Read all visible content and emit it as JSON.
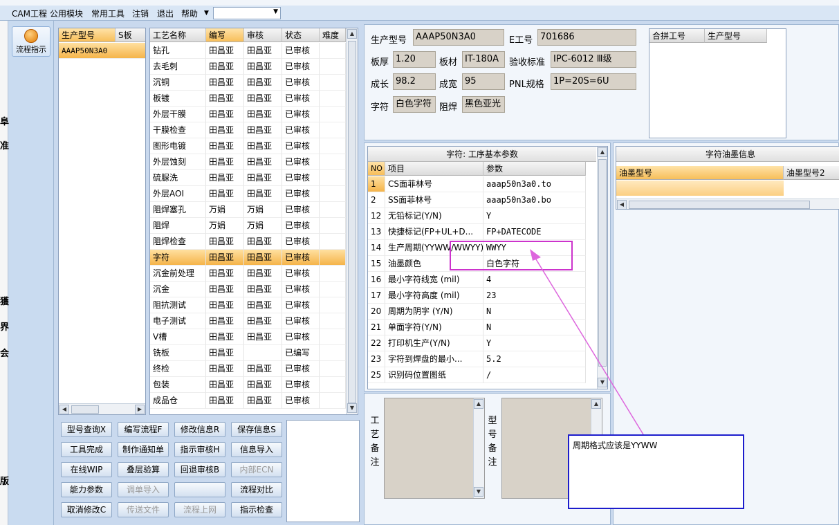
{
  "menu": [
    "CAM工程",
    "公用模块",
    "常用工具",
    "注销",
    "退出",
    "帮助"
  ],
  "nav": {
    "flow_label": "流程指示"
  },
  "left_edge_glyphs": [
    "阜",
    "准",
    "獲",
    "界",
    "会",
    "版"
  ],
  "product_list": {
    "headers": [
      "生产型号",
      "S板"
    ],
    "rows": [
      "AAAP50N3A0"
    ]
  },
  "process_table": {
    "headers": [
      "工艺名称",
      "编写",
      "审核",
      "状态",
      "难度"
    ],
    "selected_index": 13,
    "rows": [
      {
        "name": "钻孔",
        "writer": "田昌亚",
        "reviewer": "田昌亚",
        "status": "已审核"
      },
      {
        "name": "去毛刺",
        "writer": "田昌亚",
        "reviewer": "田昌亚",
        "status": "已审核"
      },
      {
        "name": "沉铜",
        "writer": "田昌亚",
        "reviewer": "田昌亚",
        "status": "已审核"
      },
      {
        "name": "板镀",
        "writer": "田昌亚",
        "reviewer": "田昌亚",
        "status": "已审核"
      },
      {
        "name": "外层干膜",
        "writer": "田昌亚",
        "reviewer": "田昌亚",
        "status": "已审核"
      },
      {
        "name": "干膜检查",
        "writer": "田昌亚",
        "reviewer": "田昌亚",
        "status": "已审核"
      },
      {
        "name": "图形电镀",
        "writer": "田昌亚",
        "reviewer": "田昌亚",
        "status": "已审核"
      },
      {
        "name": "外层蚀刻",
        "writer": "田昌亚",
        "reviewer": "田昌亚",
        "status": "已审核"
      },
      {
        "name": "硫脲洗",
        "writer": "田昌亚",
        "reviewer": "田昌亚",
        "status": "已审核"
      },
      {
        "name": "外层AOI",
        "writer": "田昌亚",
        "reviewer": "田昌亚",
        "status": "已审核"
      },
      {
        "name": "阻焊塞孔",
        "writer": "万娟",
        "reviewer": "万娟",
        "status": "已审核"
      },
      {
        "name": "阻焊",
        "writer": "万娟",
        "reviewer": "万娟",
        "status": "已审核"
      },
      {
        "name": "阻焊检查",
        "writer": "田昌亚",
        "reviewer": "田昌亚",
        "status": "已审核"
      },
      {
        "name": "字符",
        "writer": "田昌亚",
        "reviewer": "田昌亚",
        "status": "已审核"
      },
      {
        "name": "沉金前处理",
        "writer": "田昌亚",
        "reviewer": "田昌亚",
        "status": "已审核"
      },
      {
        "name": "沉金",
        "writer": "田昌亚",
        "reviewer": "田昌亚",
        "status": "已审核"
      },
      {
        "name": "阻抗测试",
        "writer": "田昌亚",
        "reviewer": "田昌亚",
        "status": "已审核"
      },
      {
        "name": "电子测试",
        "writer": "田昌亚",
        "reviewer": "田昌亚",
        "status": "已审核"
      },
      {
        "name": "V槽",
        "writer": "田昌亚",
        "reviewer": "田昌亚",
        "status": "已审核"
      },
      {
        "name": "铣板",
        "writer": "田昌亚",
        "reviewer": "",
        "status": "已编写"
      },
      {
        "name": "终检",
        "writer": "田昌亚",
        "reviewer": "田昌亚",
        "status": "已审核"
      },
      {
        "name": "包装",
        "writer": "田昌亚",
        "reviewer": "田昌亚",
        "status": "已审核"
      },
      {
        "name": "成品仓",
        "writer": "田昌亚",
        "reviewer": "田昌亚",
        "status": "已审核"
      }
    ]
  },
  "buttons": [
    {
      "label": "型号查询X",
      "enabled": true
    },
    {
      "label": "编写流程F",
      "enabled": true
    },
    {
      "label": "修改信息R",
      "enabled": true
    },
    {
      "label": "保存信息S",
      "enabled": true
    },
    {
      "label": "工具完成",
      "enabled": true
    },
    {
      "label": "制作通知单",
      "enabled": true
    },
    {
      "label": "指示审核H",
      "enabled": true
    },
    {
      "label": "信息导入",
      "enabled": true
    },
    {
      "label": "在线WIP",
      "enabled": true
    },
    {
      "label": "叠层验算",
      "enabled": true
    },
    {
      "label": "回退审核B",
      "enabled": true
    },
    {
      "label": "内部ECN",
      "enabled": false
    },
    {
      "label": "能力参数",
      "enabled": true
    },
    {
      "label": "调单导入",
      "enabled": false
    },
    {
      "label": "",
      "enabled": true
    },
    {
      "label": "流程对比",
      "enabled": true
    },
    {
      "label": "取消修改C",
      "enabled": true
    },
    {
      "label": "传送文件",
      "enabled": false
    },
    {
      "label": "流程上网",
      "enabled": false
    },
    {
      "label": "指示检查",
      "enabled": true
    }
  ],
  "info": {
    "product_label": "生产型号",
    "product": "AAAP50N3A0",
    "eno_label": "E工号",
    "eno": "701686",
    "thickness_label": "板厚",
    "thickness": "1.20",
    "material_label": "板材",
    "material": "IT-180A",
    "standard_label": "验收标准",
    "standard": "IPC-6012 Ⅲ级",
    "length_label": "成长",
    "length": "98.2",
    "width_label": "成宽",
    "width": "95",
    "pnl_label": "PNL规格",
    "pnl": "1P=20S=6U",
    "char_label": "字符",
    "char": "白色字符",
    "mask_label": "阻焊",
    "mask": "黑色亚光"
  },
  "merge_table": {
    "headers": [
      "合拼工号",
      "生产型号"
    ]
  },
  "params": {
    "title": "字符: 工序基本参数",
    "headers": [
      "NO",
      "项目",
      "参数"
    ],
    "rows": [
      {
        "no": "1",
        "item": "CS面菲林号",
        "value": "aaap50n3a0.to"
      },
      {
        "no": "2",
        "item": "SS面菲林号",
        "value": "aaap50n3a0.bo"
      },
      {
        "no": "12",
        "item": "无铅标记(Y/N)",
        "value": "Y"
      },
      {
        "no": "13",
        "item": "快捷标记(FP+UL+D...",
        "value": "FP+DATECODE"
      },
      {
        "no": "14",
        "item": "生产周期(YYWW/WWYY)",
        "value": "WWYY"
      },
      {
        "no": "15",
        "item": "油墨颜色",
        "value": "白色字符"
      },
      {
        "no": "16",
        "item": "最小字符线宽 (mil)",
        "value": "4"
      },
      {
        "no": "17",
        "item": "最小字符高度 (mil)",
        "value": "23"
      },
      {
        "no": "20",
        "item": "周期为阴字 (Y/N)",
        "value": "N"
      },
      {
        "no": "21",
        "item": "单面字符(Y/N)",
        "value": "N"
      },
      {
        "no": "22",
        "item": "打印机生产(Y/N)",
        "value": "Y"
      },
      {
        "no": "23",
        "item": "字符到焊盘的最小...",
        "value": "5.2"
      },
      {
        "no": "25",
        "item": "识别码位置图纸",
        "value": "/"
      }
    ]
  },
  "ink": {
    "title": "字符油墨信息",
    "headers": [
      "油墨型号",
      "油墨型号2"
    ]
  },
  "memo": {
    "process_label": "工艺备注",
    "model_label": "型号备注"
  },
  "annotation": {
    "text": "周期格式应该是YYWW",
    "color": "#cc33cc"
  }
}
